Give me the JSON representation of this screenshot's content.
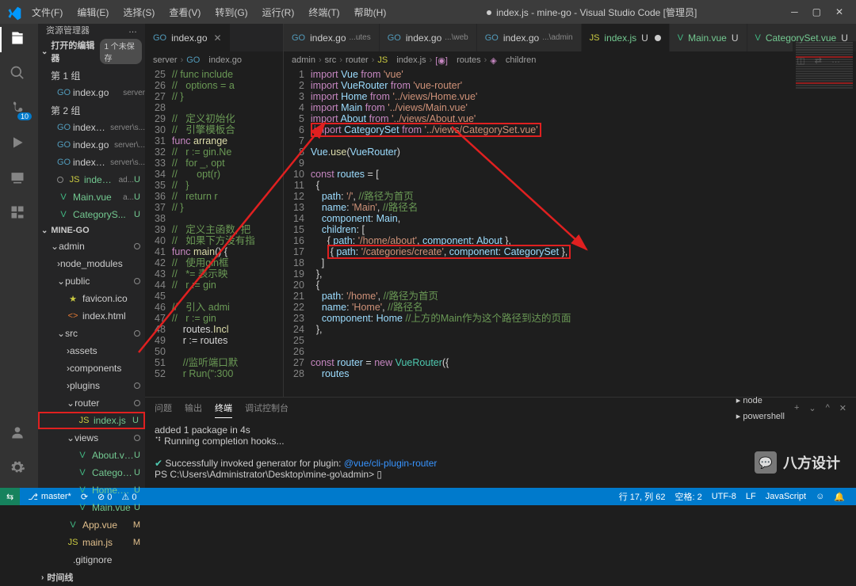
{
  "title": "index.js - mine-go - Visual Studio Code [管理员]",
  "menu": [
    "文件(F)",
    "编辑(E)",
    "选择(S)",
    "查看(V)",
    "转到(G)",
    "运行(R)",
    "终端(T)",
    "帮助(H)"
  ],
  "explorer": {
    "header": "资源管理器",
    "openEditors": {
      "title": "打开的编辑器",
      "badge": "1 个未保存"
    },
    "groups": [
      {
        "label": "第 1 组",
        "items": [
          {
            "icon": "GO",
            "iconCls": "file-go",
            "name": "index.go",
            "suffix": "server",
            "git": ""
          }
        ]
      },
      {
        "label": "第 2 组",
        "items": [
          {
            "icon": "GO",
            "iconCls": "file-go",
            "name": "index.go",
            "suffix": "server\\s...",
            "git": ""
          },
          {
            "icon": "GO",
            "iconCls": "file-go",
            "name": "index.go",
            "suffix": "server\\...",
            "git": ""
          },
          {
            "icon": "GO",
            "iconCls": "file-go",
            "name": "index.go",
            "suffix": "server\\s...",
            "git": ""
          },
          {
            "icon": "JS",
            "iconCls": "file-js",
            "name": "index.js",
            "suffix": "ad...",
            "git": "U",
            "dot": true,
            "untracked": true
          },
          {
            "icon": "V",
            "iconCls": "file-vue",
            "name": "Main.vue",
            "suffix": "a...",
            "git": "U",
            "untracked": true
          },
          {
            "icon": "V",
            "iconCls": "file-vue",
            "name": "CategoryS...",
            "suffix": "",
            "git": "U",
            "untracked": true
          }
        ]
      }
    ],
    "project": "MINE-GO",
    "tree": [
      {
        "type": "folder",
        "name": "admin",
        "indent": 0,
        "open": true,
        "dot": true
      },
      {
        "type": "folder",
        "name": "node_modules",
        "indent": 1,
        "open": false
      },
      {
        "type": "folder",
        "name": "public",
        "indent": 1,
        "open": true,
        "dot": true
      },
      {
        "type": "file",
        "name": "favicon.ico",
        "icon": "★",
        "iconCls": "file-star",
        "indent": 2
      },
      {
        "type": "file",
        "name": "index.html",
        "icon": "<>",
        "iconCls": "file-html",
        "indent": 2
      },
      {
        "type": "folder",
        "name": "src",
        "indent": 1,
        "open": true,
        "dot": true
      },
      {
        "type": "folder",
        "name": "assets",
        "indent": 2,
        "open": false
      },
      {
        "type": "folder",
        "name": "components",
        "indent": 2,
        "open": false
      },
      {
        "type": "folder",
        "name": "plugins",
        "indent": 2,
        "open": false,
        "dot": true
      },
      {
        "type": "folder",
        "name": "router",
        "indent": 2,
        "open": true,
        "dot": true
      },
      {
        "type": "file",
        "name": "index.js",
        "icon": "JS",
        "iconCls": "file-js",
        "indent": 3,
        "git": "U",
        "untracked": true,
        "redbox": true
      },
      {
        "type": "folder",
        "name": "views",
        "indent": 2,
        "open": true,
        "dot": true
      },
      {
        "type": "file",
        "name": "About.vue",
        "icon": "V",
        "iconCls": "file-vue",
        "indent": 3,
        "git": "U",
        "untracked": true
      },
      {
        "type": "file",
        "name": "CategorySet...",
        "icon": "V",
        "iconCls": "file-vue",
        "indent": 3,
        "git": "U",
        "untracked": true
      },
      {
        "type": "file",
        "name": "Home.vue",
        "icon": "V",
        "iconCls": "file-vue",
        "indent": 3,
        "git": "U",
        "untracked": true
      },
      {
        "type": "file",
        "name": "Main.vue",
        "icon": "V",
        "iconCls": "file-vue",
        "indent": 3,
        "git": "U",
        "untracked": true
      },
      {
        "type": "file",
        "name": "App.vue",
        "icon": "V",
        "iconCls": "file-vue",
        "indent": 2,
        "git": "M",
        "mod": true
      },
      {
        "type": "file",
        "name": "main.js",
        "icon": "JS",
        "iconCls": "file-js",
        "indent": 2,
        "git": "M",
        "mod": true
      },
      {
        "type": "file",
        "name": ".gitignore",
        "icon": "",
        "iconCls": "",
        "indent": 1
      },
      {
        "type": "section",
        "name": "时间线"
      }
    ]
  },
  "tabsLeft": [
    {
      "icon": "GO",
      "iconCls": "file-go",
      "name": "index.go",
      "close": true,
      "active": true
    }
  ],
  "tabsRight": [
    {
      "icon": "GO",
      "iconCls": "file-go",
      "name": "index.go",
      "suffix": "...utes"
    },
    {
      "icon": "GO",
      "iconCls": "file-go",
      "name": "index.go",
      "suffix": "...\\web"
    },
    {
      "icon": "GO",
      "iconCls": "file-go",
      "name": "index.go",
      "suffix": "...\\admin"
    },
    {
      "icon": "JS",
      "iconCls": "file-js",
      "name": "index.js",
      "git": "U",
      "untracked": true,
      "active": true,
      "dot": true
    },
    {
      "icon": "V",
      "iconCls": "file-vue",
      "name": "Main.vue",
      "git": "U",
      "untracked": true
    },
    {
      "icon": "V",
      "iconCls": "file-vue",
      "name": "CategorySet.vue",
      "git": "U",
      "untracked": true
    }
  ],
  "breadcrumbLeft": [
    "server",
    "index.go"
  ],
  "breadcrumbRight": [
    "admin",
    "src",
    "router",
    "index.js",
    "routes",
    "children"
  ],
  "codeLeft": {
    "start": 25,
    "lines": [
      "<span class='tok-cmt'>// func include</span>",
      "<span class='tok-cmt'>//   options = a</span>",
      "<span class='tok-cmt'>// }</span>",
      "",
      "<span class='tok-cmt'>//   定义初始化</span>",
      "<span class='tok-cmt'>//   引擎模板合</span>",
      "<span class='tok-kw'>func</span> <span class='tok-fn'>arrange</span>",
      "<span class='tok-cmt'>//   r := gin.Ne</span>",
      "<span class='tok-cmt'>//   for _, opt</span>",
      "<span class='tok-cmt'>//       opt(r)</span>",
      "<span class='tok-cmt'>//   }</span>",
      "<span class='tok-cmt'>//   return r</span>",
      "<span class='tok-cmt'>// }</span>",
      "",
      "<span class='tok-cmt'>//   定义主函数, 把</span>",
      "<span class='tok-cmt'>//   如果下方没有指</span>",
      "<span class='tok-kw'>func</span> <span class='tok-fn'>main</span>() {",
      "<span class='tok-cmt'>//   使用gin框</span>",
      "<span class='tok-cmt'>//   *= 表示映</span>",
      "<span class='tok-cmt'>//   r := gin</span>",
      "",
      "<span class='tok-cmt'>//   引入 admi</span>",
      "<span class='tok-cmt'>//   r := gin</span>",
      "    routes.<span class='tok-fn'>Incl</span>",
      "    r := routes",
      "",
      "<span class='tok-cmt'>    //监听端口默</span>",
      "<span class='tok-cmt'>    r Run(\":300</span>"
    ]
  },
  "codeRight": {
    "start": 1,
    "lines": [
      "<span class='tok-kw'>import</span> <span class='tok-var'>Vue</span> <span class='tok-kw'>from</span> <span class='tok-str'>'vue'</span>",
      "<span class='tok-kw'>import</span> <span class='tok-var'>VueRouter</span> <span class='tok-kw'>from</span> <span class='tok-str'>'vue-router'</span>",
      "<span class='tok-kw'>import</span> <span class='tok-var'>Home</span> <span class='tok-kw'>from</span> <span class='tok-str'>'../views/Home.vue'</span>",
      "<span class='tok-kw'>import</span> <span class='tok-var'>Main</span> <span class='tok-kw'>from</span> <span class='tok-str'>'../views/Main.vue'</span>",
      "<span class='tok-kw'>import</span> <span class='tok-var'>About</span> <span class='tok-kw'>from</span> <span class='tok-str'>'../views/About.vue'</span>",
      "<span class='line-redbox'><span class='tok-kw'>import</span> <span class='tok-var'>CategorySet</span> <span class='tok-kw'>from</span> <span class='tok-str'>'../views/CategorySet.vue'</span></span>",
      "",
      "<span class='tok-var'>Vue</span>.<span class='tok-fn'>use</span>(<span class='tok-var'>VueRouter</span>)",
      "",
      "<span class='tok-kw'>const</span> <span class='tok-var'>routes</span> = [",
      "  {",
      "    <span class='tok-prop'>path</span>: <span class='tok-str'>'/'</span>, <span class='tok-cmt'>//路径为首页</span>",
      "    <span class='tok-prop'>name</span>: <span class='tok-str'>'Main'</span>, <span class='tok-cmt'>//路径名</span>",
      "    <span class='tok-prop'>component</span>: <span class='tok-var'>Main</span>,",
      "    <span class='tok-prop'>children</span>: [",
      "      { <span class='tok-prop'>path</span>: <span class='tok-str'>'/home/about'</span>, <span class='tok-prop'>component</span>: <span class='tok-var'>About</span> },",
      "      <span class='line-redbox'>{ <span class='tok-prop'>path</span>: <span class='tok-str'>'/categories/create'</span>, <span class='tok-prop'>component</span>: <span class='tok-var'>CategorySet</span> },</span>",
      "    ]",
      "  },",
      "  {",
      "    <span class='tok-prop'>path</span>: <span class='tok-str'>'/home'</span>, <span class='tok-cmt'>//路径为首页</span>",
      "    <span class='tok-prop'>name</span>: <span class='tok-str'>'Home'</span>, <span class='tok-cmt'>//路径名</span>",
      "    <span class='tok-prop'>component</span>: <span class='tok-var'>Home</span> <span class='tok-cmt'>//上方的Main作为这个路径到达的页面</span>",
      "  },",
      "",
      "",
      "<span class='tok-kw'>const</span> <span class='tok-var'>router</span> = <span class='tok-kw'>new</span> <span class='tok-type'>VueRouter</span>({",
      "    <span class='tok-var'>routes</span>"
    ]
  },
  "terminal": {
    "tabs": [
      "问题",
      "输出",
      "终端",
      "调试控制台"
    ],
    "activeTab": 2,
    "shells": [
      "node",
      "powershell"
    ],
    "lines": [
      "added 1 package in 4s",
      "⠙  Running completion hooks...",
      "",
      "<span class='success'>✔</span>  Successfully invoked generator for plugin: <span class='link'>@vue/cli-plugin-router</span>",
      "PS C:\\Users\\Administrator\\Desktop\\mine-go\\admin> ▯"
    ]
  },
  "status": {
    "remote": "⇆",
    "branch": "master*",
    "sync": "⟳",
    "errors": "⊘ 0",
    "warnings": "⚠ 0",
    "cursor": "行 17, 列 62",
    "spaces": "空格: 2",
    "encoding": "UTF-8",
    "eol": "LF",
    "lang": "JavaScript",
    "feedback": "☺",
    "bell": "🔔"
  },
  "scmBadge": "10",
  "watermark": "八方设计"
}
